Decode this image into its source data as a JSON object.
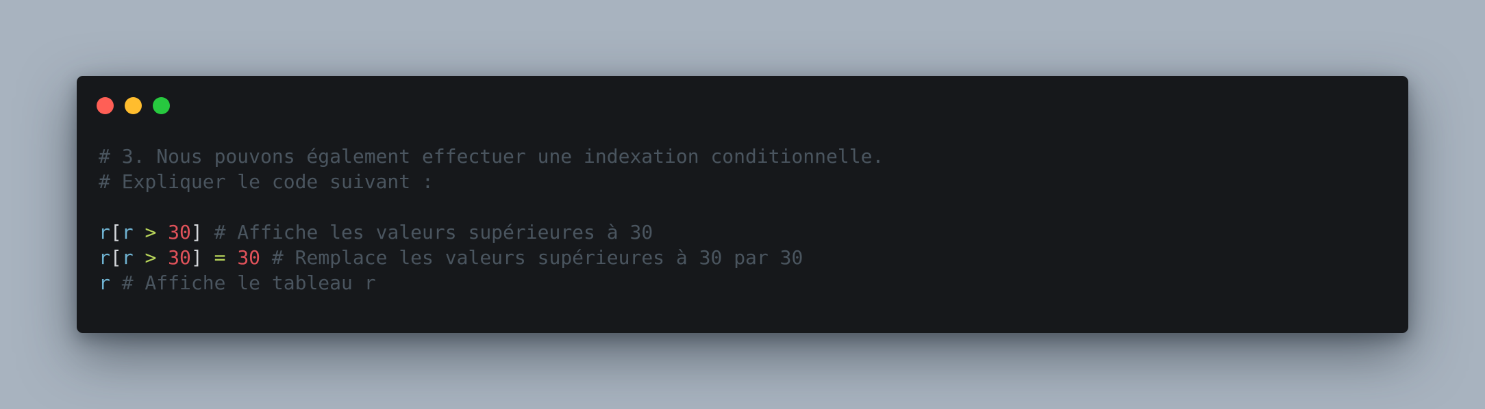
{
  "window": {
    "controls": [
      {
        "name": "close",
        "color": "#ff5f56"
      },
      {
        "name": "minimize",
        "color": "#ffbd2e"
      },
      {
        "name": "maximize",
        "color": "#27c93f"
      }
    ]
  },
  "code": {
    "language": "python",
    "lines": [
      [
        {
          "type": "comment",
          "text": "# 3. Nous pouvons également effectuer une indexation conditionnelle."
        }
      ],
      [
        {
          "type": "comment",
          "text": "# Expliquer le code suivant :"
        }
      ],
      [],
      [
        {
          "type": "var",
          "text": "r"
        },
        {
          "type": "punc",
          "text": "["
        },
        {
          "type": "var",
          "text": "r"
        },
        {
          "type": "plain",
          "text": " "
        },
        {
          "type": "op",
          "text": ">"
        },
        {
          "type": "plain",
          "text": " "
        },
        {
          "type": "num",
          "text": "30"
        },
        {
          "type": "punc",
          "text": "]"
        },
        {
          "type": "plain",
          "text": " "
        },
        {
          "type": "comment",
          "text": "# Affiche les valeurs supérieures à 30"
        }
      ],
      [
        {
          "type": "var",
          "text": "r"
        },
        {
          "type": "punc",
          "text": "["
        },
        {
          "type": "var",
          "text": "r"
        },
        {
          "type": "plain",
          "text": " "
        },
        {
          "type": "op",
          "text": ">"
        },
        {
          "type": "plain",
          "text": " "
        },
        {
          "type": "num",
          "text": "30"
        },
        {
          "type": "punc",
          "text": "]"
        },
        {
          "type": "plain",
          "text": " "
        },
        {
          "type": "op",
          "text": "="
        },
        {
          "type": "plain",
          "text": " "
        },
        {
          "type": "num",
          "text": "30"
        },
        {
          "type": "plain",
          "text": " "
        },
        {
          "type": "comment",
          "text": "# Remplace les valeurs supérieures à 30 par 30"
        }
      ],
      [
        {
          "type": "var",
          "text": "r"
        },
        {
          "type": "plain",
          "text": " "
        },
        {
          "type": "comment",
          "text": "# Affiche le tableau r"
        }
      ]
    ]
  }
}
